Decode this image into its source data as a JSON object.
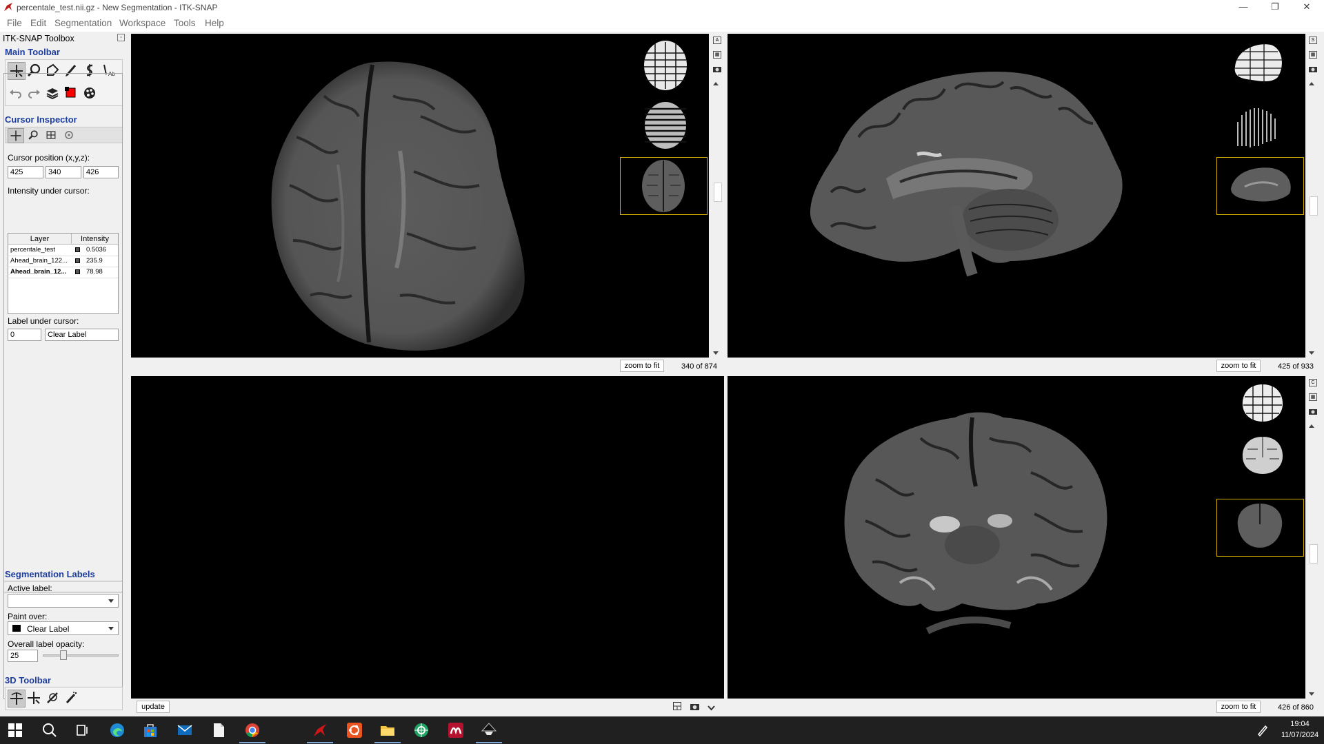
{
  "window": {
    "title": "percentale_test.nii.gz - New Segmentation - ITK-SNAP",
    "controls": {
      "minimize": "—",
      "maximize": "❐",
      "close": "✕"
    }
  },
  "menu": [
    "File",
    "Edit",
    "Segmentation",
    "Workspace",
    "Tools",
    "Help"
  ],
  "toolbox": {
    "title": "ITK-SNAP Toolbox",
    "main_toolbar_title": "Main Toolbar",
    "cursor_inspector": {
      "title": "Cursor Inspector",
      "position_label": "Cursor position (x,y,z):",
      "x": "425",
      "y": "340",
      "z": "426",
      "intensity_label": "Intensity under cursor:",
      "columns": [
        "Layer",
        "Intensity"
      ],
      "rows": [
        {
          "layer": "percentale_test",
          "intensity": "0.5036"
        },
        {
          "layer": "Ahead_brain_122...",
          "intensity": "235.9"
        },
        {
          "layer": "Ahead_brain_12...",
          "intensity": "78.98"
        }
      ],
      "label_under_cursor": "Label under cursor:",
      "label_id": "0",
      "label_name": "Clear Label"
    },
    "segmentation": {
      "title": "Segmentation Labels",
      "active_label": "Active label:",
      "active_value": "",
      "paint_over": "Paint over:",
      "paint_over_value": "Clear Label",
      "opacity_label": "Overall label opacity:",
      "opacity_value": "25",
      "opacity_fraction": 0.25
    },
    "toolbar3d_title": "3D Toolbar"
  },
  "views": {
    "axial": {
      "zoom_label": "zoom to fit",
      "slice": "340 of 874",
      "tool_letter": "A"
    },
    "sagittal": {
      "zoom_label": "zoom to fit",
      "slice": "425 of 933",
      "tool_letter": "S"
    },
    "coronal": {
      "zoom_label": "zoom to fit",
      "slice": "426 of 860",
      "tool_letter": "C"
    },
    "render3d": {
      "update_label": "update"
    }
  },
  "taskbar": {
    "time": "19:04",
    "date": "11/07/2024"
  },
  "colors": {
    "accent": "#1d3d9c",
    "selection": "#d4b000",
    "taskbar": "#202020",
    "viewport": "#000000"
  }
}
